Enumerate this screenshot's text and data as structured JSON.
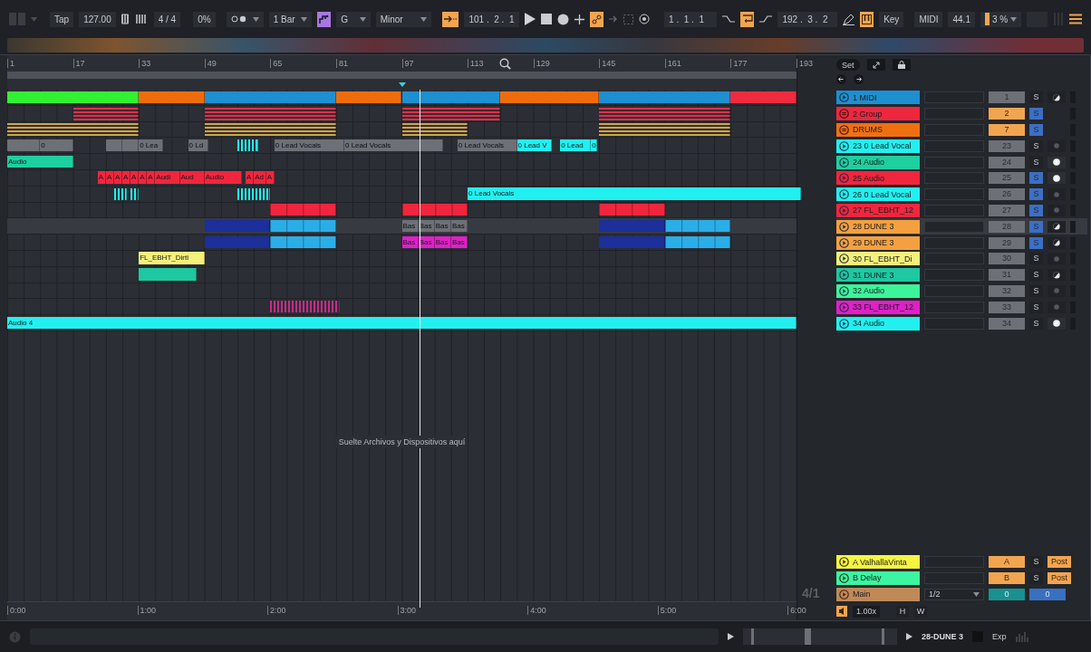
{
  "toolbar": {
    "tap": "Tap",
    "tempo": "127.00",
    "signature": "4 / 4",
    "groove": "0%",
    "quantize": "1 Bar",
    "scale_mode_on": true,
    "root": "G",
    "scale": "Minor",
    "follow_on": true,
    "position": "101 .  2 .  1",
    "automation_arm_on": true,
    "loop_start": "1 .  1 .  1",
    "loop_on": true,
    "loop_length": "192 .  3 .  2",
    "keys_on": true,
    "key": "Key",
    "midi": "MIDI",
    "sample_rate": "44.1",
    "cpu": "3 %"
  },
  "bar_ruler": [
    "1",
    "17",
    "33",
    "49",
    "65",
    "81",
    "97",
    "113",
    "129",
    "145",
    "161",
    "177",
    "193"
  ],
  "browser_controls": {
    "set": "Set"
  },
  "tracks": [
    {
      "name": "1 MIDI",
      "color": "#1e8fd0",
      "kind": "track",
      "number": "1",
      "solo": {
        "label": "S",
        "on": false
      },
      "monitor_auto": true,
      "selected": false,
      "clips": [
        {
          "kind": "block",
          "color": "#32f032",
          "active": true
        },
        {
          "kind": "block",
          "color": "#ef6c0c",
          "active": true
        },
        {
          "kind": "block",
          "color": "#1e8fd0",
          "active": true
        },
        {
          "kind": "block",
          "color": "#ef6c0c",
          "active": true
        },
        {
          "kind": "block",
          "color": "#1e8fd0",
          "active": true
        },
        {
          "kind": "block",
          "color": "#ef6c0c",
          "active": true
        },
        {
          "kind": "block",
          "color": "#1e8fd0",
          "active": true
        },
        {
          "kind": "block",
          "color": "#ef2b3d",
          "active": true
        }
      ]
    },
    {
      "name": "2 Group",
      "color": "#f0263e",
      "kind": "group",
      "number": "2",
      "solo": {
        "label": "S",
        "on": true
      },
      "selected": false,
      "clips": [
        {
          "kind": "stripes",
          "color": "#e0304a",
          "active": true
        },
        {
          "kind": "stripes",
          "color": "#e0304a",
          "active": true
        },
        {
          "kind": "stripes",
          "color": "#e0304a",
          "active": true
        },
        {
          "kind": "stripes",
          "color": "#e0304a",
          "active": true
        }
      ]
    },
    {
      "name": "DRUMS",
      "color": "#f07010",
      "kind": "group",
      "number": "7",
      "solo": {
        "label": "S",
        "on": true
      },
      "selected": false,
      "clips": [
        {
          "kind": "stripes",
          "color": "#c8a848",
          "active": true
        },
        {
          "kind": "stripes",
          "color": "#c8a848",
          "active": true
        },
        {
          "kind": "stripes",
          "color": "#c8a848",
          "active": true
        },
        {
          "kind": "stripes",
          "color": "#c8a848",
          "active": true
        }
      ]
    },
    {
      "name": "23 0 Lead Vocal",
      "color": "#22f0f0",
      "kind": "track",
      "number": "23",
      "solo": {
        "label": "S",
        "on": false
      },
      "monitor_auto": false,
      "monitor_on": false,
      "selected": false,
      "clips": [
        {
          "kind": "block",
          "active": false
        },
        {
          "kind": "block",
          "active": false,
          "label": "0"
        },
        {
          "kind": "block",
          "active": false
        },
        {
          "kind": "block",
          "active": false
        },
        {
          "kind": "block",
          "active": false,
          "label": "0 Lea"
        },
        {
          "kind": "block",
          "active": false,
          "label": "0 Ld"
        },
        {
          "kind": "ticks",
          "color": "#22f0f0",
          "active": true
        },
        {
          "kind": "block",
          "active": false,
          "label": "0 Lead Vocals"
        },
        {
          "kind": "block",
          "active": false,
          "label": "0 Lead Vocals"
        },
        {
          "kind": "block",
          "active": false,
          "label": "0 Lead Vocals"
        },
        {
          "kind": "block",
          "color": "#22f0f0",
          "active": true,
          "label": "0 Lead V"
        },
        {
          "kind": "block",
          "color": "#22f0f0",
          "active": true,
          "label": "0 Lead"
        },
        {
          "kind": "block",
          "color": "#22f0f0",
          "active": true,
          "label": "0"
        }
      ]
    },
    {
      "name": "24 Audio",
      "color": "#1ed0a0",
      "kind": "track",
      "number": "24",
      "solo": {
        "label": "S",
        "on": false
      },
      "monitor_auto": false,
      "monitor_on": true,
      "selected": false,
      "clips": [
        {
          "kind": "block",
          "color": "#1ed0a0",
          "active": true,
          "label": "Audio"
        }
      ]
    },
    {
      "name": "25 Audio",
      "color": "#f0263e",
      "kind": "track",
      "number": "25",
      "solo": {
        "label": "S",
        "on": true
      },
      "monitor_auto": false,
      "monitor_on": true,
      "selected": false,
      "clips": [
        {
          "kind": "block",
          "color": "#f0263e",
          "active": true,
          "label": "A"
        },
        {
          "kind": "block",
          "color": "#f0263e",
          "active": true,
          "label": "A"
        },
        {
          "kind": "block",
          "color": "#f0263e",
          "active": true,
          "label": "A"
        },
        {
          "kind": "block",
          "color": "#f0263e",
          "active": true,
          "label": "A"
        },
        {
          "kind": "block",
          "color": "#f0263e",
          "active": true,
          "label": "A"
        },
        {
          "kind": "block",
          "color": "#f0263e",
          "active": true,
          "label": "A"
        },
        {
          "kind": "block",
          "color": "#f0263e",
          "active": true,
          "label": "A"
        },
        {
          "kind": "block",
          "color": "#f0263e",
          "active": true,
          "label": "Audi"
        },
        {
          "kind": "block",
          "color": "#f0263e",
          "active": true,
          "label": "Aud"
        },
        {
          "kind": "block",
          "color": "#f0263e",
          "active": true,
          "label": "Audio"
        },
        {
          "kind": "block",
          "color": "#f0263e",
          "active": true,
          "label": "A"
        },
        {
          "kind": "block",
          "color": "#f0263e",
          "active": true,
          "label": "Ad"
        },
        {
          "kind": "block",
          "color": "#f0263e",
          "active": true,
          "label": "A"
        }
      ]
    },
    {
      "name": "26 0 Lead Vocal",
      "color": "#22f0f0",
      "kind": "track",
      "number": "26",
      "solo": {
        "label": "S",
        "on": true
      },
      "monitor_auto": false,
      "monitor_on": false,
      "selected": false,
      "clips": [
        {
          "kind": "ticks",
          "color": "#22f0f0",
          "active": true
        },
        {
          "kind": "ticks",
          "color": "#22f0f0",
          "active": true
        },
        {
          "kind": "ticks",
          "color": "#22f0f0",
          "active": true
        },
        {
          "kind": "block",
          "color": "#22f0f0",
          "active": true,
          "label": "0 Lead Vocals"
        }
      ]
    },
    {
      "name": "27 FL_EBHT_12",
      "color": "#f0263e",
      "kind": "track",
      "number": "27",
      "solo": {
        "label": "S",
        "on": true
      },
      "monitor_auto": false,
      "monitor_on": false,
      "selected": false,
      "clips": [
        {
          "kind": "segmented",
          "color": "#f0263e",
          "active": true
        },
        {
          "kind": "segmented",
          "color": "#f0263e",
          "active": true
        },
        {
          "kind": "segmented",
          "color": "#f0263e",
          "active": true
        }
      ]
    },
    {
      "name": "28 DUNE 3",
      "color": "#f5a040",
      "kind": "track",
      "number": "28",
      "solo": {
        "label": "S",
        "on": true
      },
      "monitor_auto": true,
      "selected": true,
      "clips": [
        {
          "kind": "block",
          "color": "#1c2f9a",
          "active": true
        },
        {
          "kind": "segmented",
          "color": "#2aaee8",
          "active": true
        },
        {
          "kind": "block",
          "active": false,
          "label": "Bas"
        },
        {
          "kind": "block",
          "active": false,
          "label": "Bas"
        },
        {
          "kind": "block",
          "active": false,
          "label": "Bas"
        },
        {
          "kind": "block",
          "active": false,
          "label": "Bas"
        },
        {
          "kind": "block",
          "color": "#1c2f9a",
          "active": true
        },
        {
          "kind": "segmented",
          "color": "#2aaee8",
          "active": true
        }
      ]
    },
    {
      "name": "29 DUNE 3",
      "color": "#f5a040",
      "kind": "track",
      "number": "29",
      "solo": {
        "label": "S",
        "on": true
      },
      "monitor_auto": true,
      "selected": false,
      "clips": [
        {
          "kind": "block",
          "color": "#1c2f9a",
          "active": true
        },
        {
          "kind": "segmented",
          "color": "#2aaee8",
          "active": true
        },
        {
          "kind": "block",
          "color": "#e020c8",
          "active": true,
          "label": "Bas"
        },
        {
          "kind": "block",
          "color": "#e020c8",
          "active": true,
          "label": "Bas"
        },
        {
          "kind": "block",
          "color": "#e020c8",
          "active": true,
          "label": "Bas"
        },
        {
          "kind": "block",
          "color": "#e020c8",
          "active": true,
          "label": "Bas"
        },
        {
          "kind": "block",
          "color": "#1c2f9a",
          "active": true
        },
        {
          "kind": "segmented",
          "color": "#2aaee8",
          "active": true
        }
      ]
    },
    {
      "name": "30 FL_EBHT_Di",
      "color": "#f5f07a",
      "kind": "track",
      "number": "30",
      "solo": {
        "label": "S",
        "on": false
      },
      "monitor_auto": false,
      "monitor_on": false,
      "selected": false,
      "clips": [
        {
          "kind": "block",
          "color": "#f5f07a",
          "active": true,
          "label": "FL_EBHT_Dirtl"
        }
      ]
    },
    {
      "name": "31 DUNE 3",
      "color": "#1ec8a0",
      "kind": "track",
      "number": "31",
      "solo": {
        "label": "S",
        "on": false
      },
      "monitor_auto": true,
      "selected": false,
      "clips": [
        {
          "kind": "block",
          "color": "#1ec8a0",
          "active": true
        }
      ]
    },
    {
      "name": "32 Audio",
      "color": "#3cf59a",
      "kind": "track",
      "number": "32",
      "solo": {
        "label": "S",
        "on": false
      },
      "monitor_auto": false,
      "monitor_on": false,
      "selected": false
    },
    {
      "name": "33 FL_EBHT_12",
      "color": "#e020c8",
      "kind": "track",
      "number": "33",
      "solo": {
        "label": "S",
        "on": false
      },
      "monitor_auto": false,
      "monitor_on": false,
      "selected": false,
      "clips": [
        {
          "kind": "ticks",
          "color": "#c82a8a",
          "active": true
        }
      ]
    },
    {
      "name": "34 Audio",
      "color": "#22f0f0",
      "kind": "track",
      "number": "34",
      "solo": {
        "label": "S",
        "on": false
      },
      "monitor_auto": false,
      "monitor_on": true,
      "selected": false,
      "clips": [
        {
          "kind": "block",
          "color": "#22f0f0",
          "active": true,
          "label": "Audio 4"
        }
      ]
    }
  ],
  "drop_hint": "Suelte Archivos y Dispositivos aquí",
  "returns": [
    {
      "name": "A ValhallaVinta",
      "color": "#f5f542",
      "send": "A",
      "solo": "S",
      "mode": "Post"
    },
    {
      "name": "B Delay",
      "color": "#3cf5a0",
      "send": "B",
      "solo": "S",
      "mode": "Post"
    }
  ],
  "main": {
    "name": "Main",
    "color": "#c08a58",
    "output": "1/2",
    "volume": "0",
    "pan": "0"
  },
  "zoom_ratio": "4/1",
  "time_ruler": [
    "0:00",
    "1:00",
    "2:00",
    "3:00",
    "4:00",
    "5:00",
    "6:00"
  ],
  "bottom_controls": {
    "speed": "1.00x",
    "h": "H",
    "w": "W"
  },
  "status_bar": {
    "selected_track": "28-DUNE 3",
    "label": "Exp"
  }
}
